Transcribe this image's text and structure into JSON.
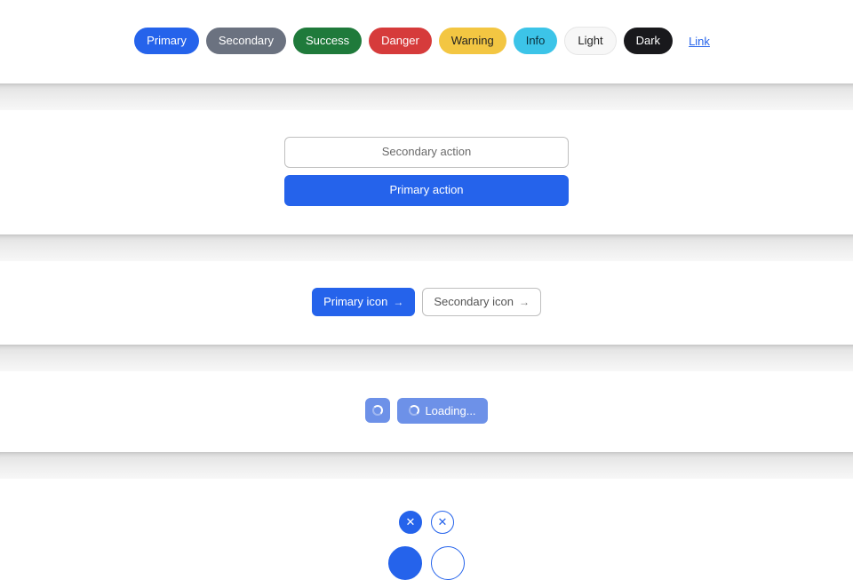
{
  "pills": {
    "primary": "Primary",
    "secondary": "Secondary",
    "success": "Success",
    "danger": "Danger",
    "warning": "Warning",
    "info": "Info",
    "light": "Light",
    "dark": "Dark",
    "link": "Link"
  },
  "stack": {
    "secondary": "Secondary action",
    "primary": "Primary action"
  },
  "iconButtons": {
    "primary": "Primary icon",
    "secondary": "Secondary icon"
  },
  "loading": {
    "label": "Loading..."
  }
}
